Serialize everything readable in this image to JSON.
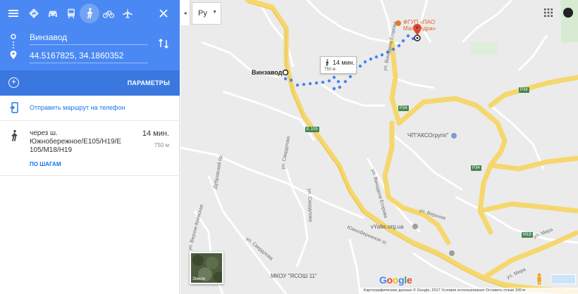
{
  "panel": {
    "travel_modes": [
      {
        "name": "best-route",
        "icon": "diamond-direction-icon"
      },
      {
        "name": "drive",
        "icon": "car-icon"
      },
      {
        "name": "transit",
        "icon": "train-icon"
      },
      {
        "name": "walk",
        "icon": "walk-icon",
        "selected": true
      },
      {
        "name": "bike",
        "icon": "bike-icon"
      },
      {
        "name": "flight",
        "icon": "plane-icon"
      }
    ],
    "origin": "Винзавод",
    "destination": "44.5167825, 34.1860352",
    "params_label": "ПАРАМЕТРЫ",
    "send_to_phone": "Отправить маршрут на телефон",
    "route": {
      "via": "через ш. Южнобережное/E105/H19/E 105/M18/H19",
      "duration": "14 мин.",
      "distance": "750 м",
      "steps_link": "ПО ШАГАМ"
    },
    "header_color": "#4a89f3"
  },
  "map": {
    "lang_value": "Ру",
    "bubble": {
      "duration": "14 мин.",
      "distance": "750 м"
    },
    "origin_label": "Винзавод",
    "poi_top": "ФГУП «ПАО Массандра»",
    "poi_akso": "ЧП\"АКСОгрупп\"",
    "poi_vyalta": "vYalte.org.ua",
    "poi_school": "МКОУ \"ЯСОШ 11\"",
    "streets": {
      "e105": "E 105",
      "egorova_1": "ул. Винодела Егорова",
      "egorova_2": "ул. Винодела Егорова",
      "verhnyaya": "ул. Верхняя",
      "sverdlova_1": "ул. Свердлова",
      "sverdlova_2": "ул. Свердлова",
      "sverdlova_3": "ул. Свердлова",
      "yuzhnoberezh": "Южнобережное ш.",
      "mira_1": "ул. Мира",
      "mira_2": "ул. Мира",
      "p34_a": "P34",
      "p34_b": "P34",
      "p34_c": "P34",
      "m18": "M18",
      "dubrovsky": "Дубровский пр.",
      "verhne_kievskaya": "ул. Верхне-Киевская"
    },
    "earth_label": "Земля",
    "google": "Google",
    "attribution": "Картографические данные © Google, 2017    Условия использования    Оставить отзыв    100 м",
    "route_color": "#4285f4"
  }
}
